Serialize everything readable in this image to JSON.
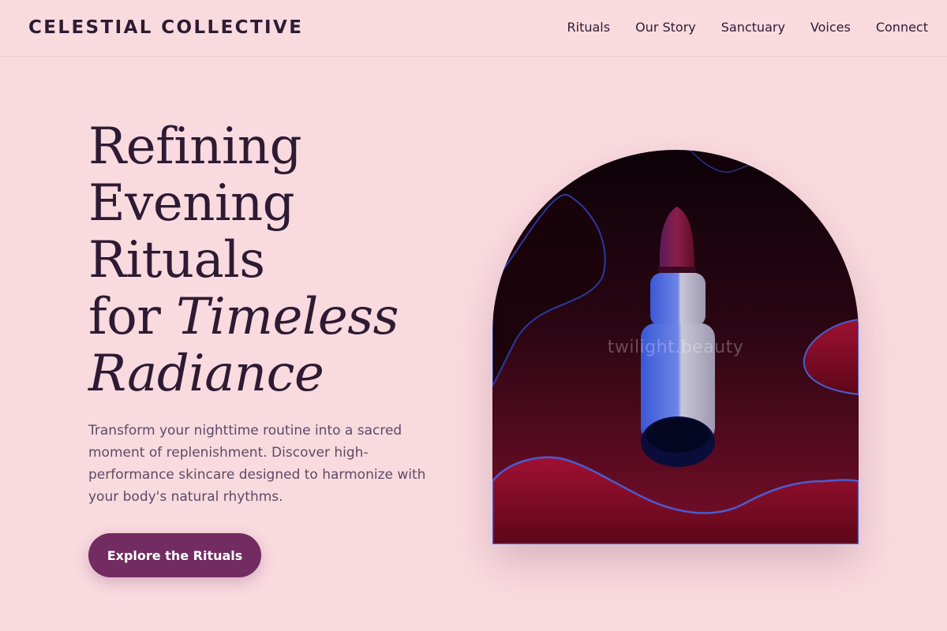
{
  "brand": {
    "name": "CELESTIAL COLLECTIVE"
  },
  "nav": {
    "items": [
      {
        "label": "Rituals"
      },
      {
        "label": "Our Story"
      },
      {
        "label": "Sanctuary"
      },
      {
        "label": "Voices"
      },
      {
        "label": "Connect"
      }
    ]
  },
  "hero": {
    "headline": {
      "line1": "Refining",
      "line2": "Evening",
      "line3": "Rituals",
      "line4_plain": "for ",
      "line4_italic": "Timeless",
      "line5_italic": "Radiance"
    },
    "description": "Transform your nighttime routine into a sacred moment of replenishment. Discover high-performance skincare designed to harmonize with your body's natural rhythms.",
    "cta_label": "Explore the Rituals",
    "image": {
      "watermark": "twilight.beauty",
      "subject": "lipstick-on-dark-red-background"
    }
  },
  "colors": {
    "background": "#f9dadf",
    "text": "#2d1b33",
    "accent": "#722c62",
    "body_text": "#5e4a62"
  }
}
